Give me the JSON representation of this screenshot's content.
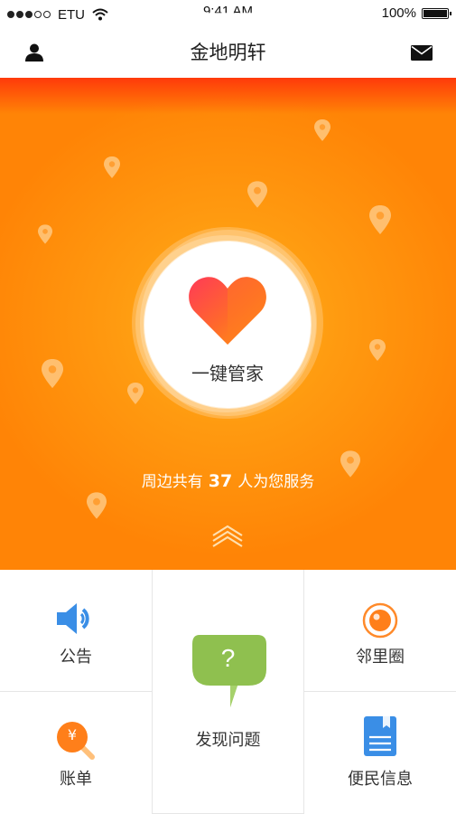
{
  "status_bar": {
    "carrier": "ETU",
    "time": "9:41 AM",
    "battery": "100%",
    "signal_dots": 3
  },
  "nav": {
    "title": "金地明轩",
    "left_icon": "person-icon",
    "right_icon": "mail-icon"
  },
  "hero": {
    "button_label": "一键管家",
    "serve_prefix": "周边共有",
    "serve_count": "37",
    "serve_suffix": "人为您服务",
    "accent": "#ff8a0a"
  },
  "grid": {
    "announcement": "公告",
    "neighborhood": "邻里圈",
    "report_issue": "发现问题",
    "bill": "账单",
    "info": "便民信息",
    "currency_symbol": "¥",
    "question_mark": "?"
  },
  "colors": {
    "blue": "#3a8ee6",
    "orange": "#ff7f1a",
    "green": "#8fc04f"
  }
}
